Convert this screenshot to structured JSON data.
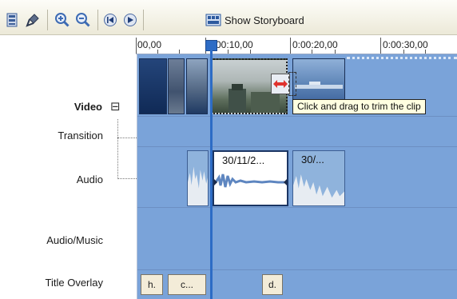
{
  "toolbar": {
    "icons": [
      "storyboard-view-icon",
      "narrate-timeline-icon",
      "zoom-in-icon",
      "zoom-out-icon",
      "rewind-icon",
      "play-icon",
      "storyboard-icon"
    ],
    "show_storyboard_label": "Show Storyboard"
  },
  "ruler": {
    "labels": [
      "00,00",
      "0:00:10,00",
      "0:00:20,00",
      "0:00:30,00"
    ]
  },
  "tracks": {
    "video_label": "Video",
    "video_collapse": "⊟",
    "transition_label": "Transition",
    "audio_label": "Audio",
    "audio_music_label": "Audio/Music",
    "title_overlay_label": "Title Overlay"
  },
  "audio_clips": {
    "clip1_title": "30/11/2...",
    "clip2_title": "30/..."
  },
  "title_overlay_clips": [
    "h.",
    "c...",
    "d."
  ],
  "tooltip": "Click and drag to trim the clip",
  "colors": {
    "track_bg": "#7aa3d9",
    "playhead": "#2d6cc5",
    "tooltip_bg": "#ffffe1",
    "trim_arrow": "#e0322e"
  }
}
